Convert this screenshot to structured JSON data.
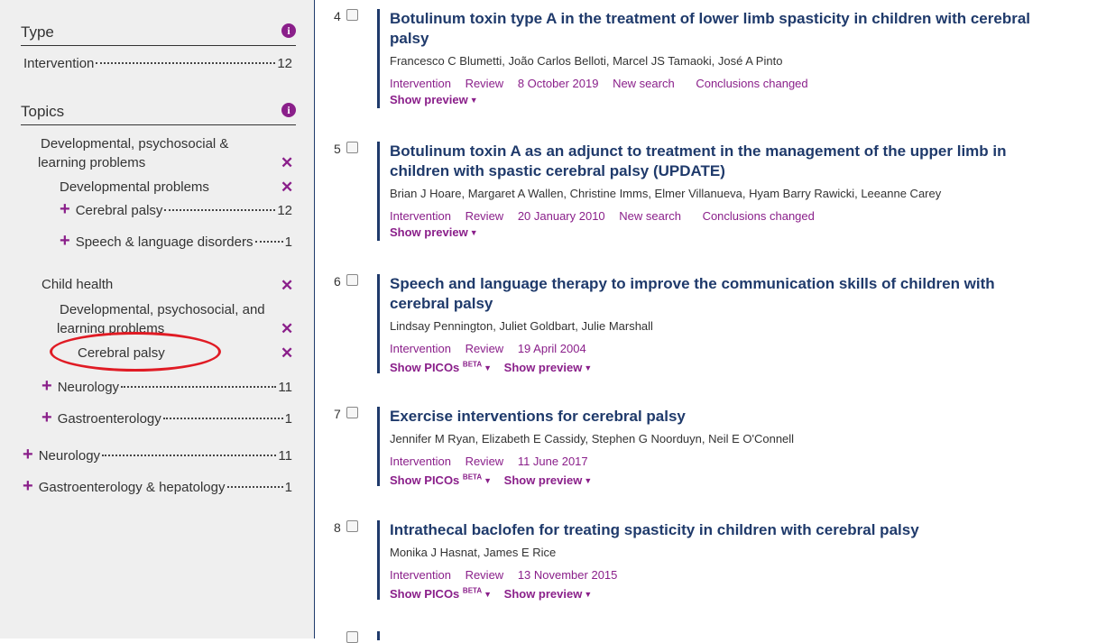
{
  "sidebar": {
    "type_section": {
      "title": "Type",
      "items": [
        {
          "label": "Intervention",
          "count": "12"
        }
      ]
    },
    "topics_section": {
      "title": "Topics",
      "selected": [
        {
          "label_line1": "Developmental, psychosocial &",
          "label_line2": "learning problems"
        },
        {
          "label": "Developmental problems"
        },
        {
          "label": "Child health"
        },
        {
          "label_line1": "Developmental, psychosocial, and",
          "label_line2": "learning problems"
        },
        {
          "label": "Cerebral palsy"
        }
      ],
      "expandable": [
        {
          "label": "Cerebral palsy",
          "count": "12"
        },
        {
          "label": "Speech & language disorders",
          "count": "1"
        },
        {
          "label": "Neurology",
          "count": "11"
        },
        {
          "label": "Gastroenterology",
          "count": "1"
        },
        {
          "label": "Neurology",
          "count": "11"
        },
        {
          "label": "Gastroenterology & hepatology",
          "count": "1"
        }
      ]
    }
  },
  "results": [
    {
      "number": "4",
      "title": "Botulinum toxin type A in the treatment of lower limb spasticity in children with cerebral palsy",
      "authors": "Francesco C Blumetti, João Carlos Belloti, Marcel JS Tamaoki, José A Pinto",
      "type": "Intervention",
      "stage": "Review",
      "date": "8 October 2019",
      "flags": [
        "New search",
        "Conclusions changed"
      ],
      "show_picos": "",
      "show_preview": "Show preview"
    },
    {
      "number": "5",
      "title": "Botulinum toxin A as an adjunct to treatment in the management of the upper limb in children with spastic cerebral palsy (UPDATE)",
      "authors": "Brian J Hoare, Margaret A Wallen, Christine Imms, Elmer Villanueva, Hyam Barry Rawicki, Leeanne Carey",
      "type": "Intervention",
      "stage": "Review",
      "date": "20 January 2010",
      "flags": [
        "New search",
        "Conclusions changed"
      ],
      "show_picos": "",
      "show_preview": "Show preview"
    },
    {
      "number": "6",
      "title": "Speech and language therapy to improve the communication skills of children with cerebral palsy",
      "authors": "Lindsay Pennington, Juliet Goldbart, Julie Marshall",
      "type": "Intervention",
      "stage": "Review",
      "date": "19 April 2004",
      "flags": [],
      "show_picos": "Show PICOs",
      "show_preview": "Show preview"
    },
    {
      "number": "7",
      "title": "Exercise interventions for cerebral palsy",
      "authors": "Jennifer M Ryan, Elizabeth E Cassidy, Stephen G Noorduyn, Neil E O'Connell",
      "type": "Intervention",
      "stage": "Review",
      "date": "11 June 2017",
      "flags": [],
      "show_picos": "Show PICOs",
      "show_preview": "Show preview"
    },
    {
      "number": "8",
      "title": "Intrathecal baclofen for treating spasticity in children with cerebral palsy",
      "authors": "Monika J Hasnat, James E Rice",
      "type": "Intervention",
      "stage": "Review",
      "date": "13 November 2015",
      "flags": [],
      "show_picos": "Show PICOs",
      "show_preview": "Show preview"
    }
  ],
  "beta_label": "BETA",
  "colors": {
    "accent": "#8a1f8a",
    "title": "#1f3a6b",
    "annotation": "#e01b24"
  }
}
